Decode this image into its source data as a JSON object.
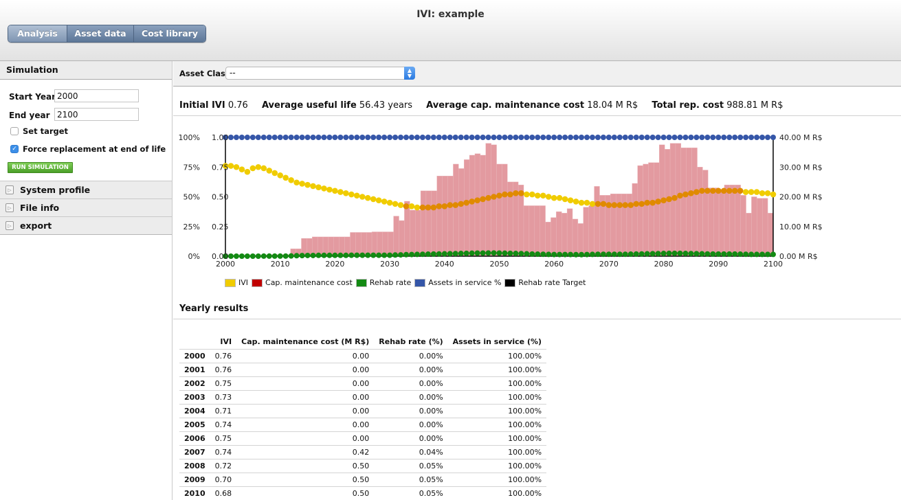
{
  "app": {
    "title": "IVI:  example"
  },
  "tabs": [
    {
      "label": "Analysis",
      "active": true
    },
    {
      "label": "Asset data",
      "active": false
    },
    {
      "label": "Cost library",
      "active": false
    }
  ],
  "sidebar": {
    "header": "Simulation",
    "start_year_label": "Start Year",
    "start_year_value": "2000",
    "end_year_label": "End year",
    "end_year_value": "2100",
    "set_target_label": "Set target",
    "set_target_checked": false,
    "force_replacement_label": "Force replacement at end of life",
    "force_replacement_checked": true,
    "run_button": "RUN SIMULATION",
    "sections": [
      {
        "label": "System profile",
        "icon": "expand-arrow-icon"
      },
      {
        "label": "File info",
        "icon": "expand-arrow-icon"
      },
      {
        "label": "export",
        "icon": "expand-arrow-icon"
      }
    ]
  },
  "asset_class": {
    "label": "Asset Class",
    "value": "--"
  },
  "stats": [
    {
      "key": "Initial IVI",
      "value": "0.76"
    },
    {
      "key": "Average useful life",
      "value": "56.43 years"
    },
    {
      "key": "Average cap. maintenance cost",
      "value": "18.04 M R$"
    },
    {
      "key": "Total rep. cost",
      "value": "988.81 M R$"
    }
  ],
  "colors": {
    "ivi": "#f0cc00",
    "ivi_overlap": "#e08a00",
    "cost": "#e39aa0",
    "rehab": "#138a13",
    "assets": "#3556a8",
    "target": "#000000"
  },
  "chart_data": {
    "type": "bar+line",
    "x_range": [
      2000,
      2100
    ],
    "x_ticks": [
      "2000",
      "2010",
      "2020",
      "2030",
      "2040",
      "2050",
      "2060",
      "2070",
      "2080",
      "2090",
      "2100"
    ],
    "y_left_outer_ticks": [
      "0%",
      "25%",
      "50%",
      "75%",
      "100%"
    ],
    "y_left_inner_ticks": [
      "0.00",
      "0.25",
      "0.50",
      "0.75",
      "1.00"
    ],
    "y_left_range": [
      0,
      1
    ],
    "y_right_ticks": [
      "0.00 M R$",
      "10.00 M R$",
      "20.00 M R$",
      "30.00 M R$",
      "40.00 M R$"
    ],
    "y_right_range": [
      0,
      40
    ],
    "legend": [
      {
        "name": "IVI",
        "color": "#f0cc00"
      },
      {
        "name": "Cap. maintenance cost",
        "color": "#c00000"
      },
      {
        "name": "Rehab rate",
        "color": "#138a13"
      },
      {
        "name": "Assets in service %",
        "color": "#3556a8"
      },
      {
        "name": "Rehab rate Target",
        "color": "#000000"
      }
    ],
    "series": [
      {
        "name": "Cap. maintenance cost",
        "axis": "right",
        "kind": "bar",
        "values": [
          0,
          0,
          0,
          0,
          0,
          0,
          0,
          0.42,
          0.5,
          0.5,
          0.5,
          0.5,
          2.5,
          2.5,
          6,
          6,
          6.5,
          6.5,
          6.5,
          6.5,
          6.5,
          6.5,
          6.5,
          8,
          8,
          8,
          8,
          8.2,
          8.2,
          8.2,
          8.2,
          13.5,
          12,
          18.5,
          15.5,
          15.5,
          22,
          22,
          22,
          27,
          27,
          27,
          31,
          29.5,
          32.5,
          34,
          34.5,
          34,
          38,
          37.5,
          31,
          31,
          25,
          25,
          24,
          17,
          17,
          17,
          17,
          11.5,
          13,
          15,
          14.5,
          16,
          12.5,
          11,
          16.5,
          17,
          23.5,
          20.5,
          20.5,
          21,
          21,
          21,
          21,
          24.5,
          30.5,
          31,
          31.5,
          31.5,
          37.5,
          36,
          38,
          38,
          36.5,
          36.5,
          36.5,
          30,
          29,
          23,
          23,
          22.5,
          24,
          24,
          24,
          20.5,
          14.5,
          20,
          19.5,
          19.5,
          14.5
        ]
      },
      {
        "name": "IVI",
        "axis": "left",
        "kind": "dots",
        "values": [
          0.76,
          0.76,
          0.75,
          0.73,
          0.71,
          0.74,
          0.75,
          0.74,
          0.72,
          0.7,
          0.68,
          0.66,
          0.64,
          0.62,
          0.61,
          0.6,
          0.59,
          0.58,
          0.57,
          0.56,
          0.55,
          0.54,
          0.53,
          0.52,
          0.51,
          0.5,
          0.49,
          0.48,
          0.47,
          0.46,
          0.45,
          0.44,
          0.43,
          0.42,
          0.42,
          0.41,
          0.41,
          0.41,
          0.41,
          0.42,
          0.42,
          0.43,
          0.43,
          0.44,
          0.45,
          0.46,
          0.47,
          0.48,
          0.49,
          0.5,
          0.51,
          0.52,
          0.52,
          0.53,
          0.53,
          0.52,
          0.52,
          0.51,
          0.51,
          0.5,
          0.49,
          0.49,
          0.48,
          0.47,
          0.46,
          0.45,
          0.45,
          0.44,
          0.44,
          0.44,
          0.43,
          0.43,
          0.43,
          0.43,
          0.43,
          0.44,
          0.44,
          0.45,
          0.45,
          0.46,
          0.47,
          0.48,
          0.49,
          0.51,
          0.52,
          0.53,
          0.54,
          0.55,
          0.55,
          0.55,
          0.55,
          0.55,
          0.55,
          0.55,
          0.55,
          0.54,
          0.54,
          0.54,
          0.53,
          0.53,
          0.52
        ]
      },
      {
        "name": "Rehab rate",
        "axis": "left",
        "kind": "dots",
        "values": [
          0,
          0,
          0,
          0,
          0,
          0,
          0,
          0.0004,
          0.0005,
          0.0005,
          0.0005,
          0.001,
          0.002,
          0.004,
          0.005,
          0.006,
          0.006,
          0.007,
          0.007,
          0.007,
          0.007,
          0.007,
          0.007,
          0.008,
          0.008,
          0.008,
          0.008,
          0.008,
          0.008,
          0.008,
          0.008,
          0.01,
          0.011,
          0.013,
          0.014,
          0.015,
          0.016,
          0.017,
          0.018,
          0.019,
          0.02,
          0.021,
          0.022,
          0.023,
          0.024,
          0.025,
          0.026,
          0.026,
          0.027,
          0.027,
          0.026,
          0.025,
          0.024,
          0.023,
          0.022,
          0.02,
          0.018,
          0.017,
          0.016,
          0.015,
          0.014,
          0.014,
          0.014,
          0.014,
          0.013,
          0.013,
          0.014,
          0.015,
          0.016,
          0.016,
          0.016,
          0.016,
          0.016,
          0.016,
          0.017,
          0.018,
          0.019,
          0.02,
          0.021,
          0.022,
          0.023,
          0.024,
          0.024,
          0.024,
          0.023,
          0.022,
          0.021,
          0.02,
          0.019,
          0.018,
          0.018,
          0.018,
          0.018,
          0.018,
          0.017,
          0.016,
          0.015,
          0.015,
          0.015,
          0.015,
          0.015
        ]
      },
      {
        "name": "Assets in service %",
        "axis": "left",
        "kind": "dots",
        "values": "1.00 for all years 2000-2100"
      }
    ]
  },
  "results": {
    "title": "Yearly results",
    "columns": [
      "",
      "IVI",
      "Cap. maintenance cost (M R$)",
      "Rehab rate (%)",
      "Assets in service (%)"
    ],
    "rows": [
      [
        "2000",
        "0.76",
        "0.00",
        "0.00%",
        "100.00%"
      ],
      [
        "2001",
        "0.76",
        "0.00",
        "0.00%",
        "100.00%"
      ],
      [
        "2002",
        "0.75",
        "0.00",
        "0.00%",
        "100.00%"
      ],
      [
        "2003",
        "0.73",
        "0.00",
        "0.00%",
        "100.00%"
      ],
      [
        "2004",
        "0.71",
        "0.00",
        "0.00%",
        "100.00%"
      ],
      [
        "2005",
        "0.74",
        "0.00",
        "0.00%",
        "100.00%"
      ],
      [
        "2006",
        "0.75",
        "0.00",
        "0.00%",
        "100.00%"
      ],
      [
        "2007",
        "0.74",
        "0.42",
        "0.04%",
        "100.00%"
      ],
      [
        "2008",
        "0.72",
        "0.50",
        "0.05%",
        "100.00%"
      ],
      [
        "2009",
        "0.70",
        "0.50",
        "0.05%",
        "100.00%"
      ],
      [
        "2010",
        "0.68",
        "0.50",
        "0.05%",
        "100.00%"
      ]
    ]
  }
}
